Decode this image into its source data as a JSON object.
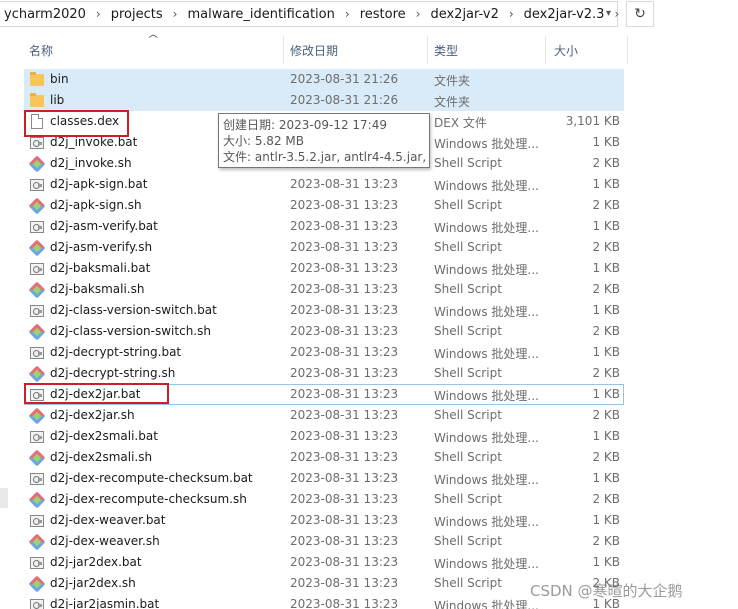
{
  "breadcrumb": [
    "ycharm2020",
    "projects",
    "malware_identification",
    "restore",
    "dex2jar-v2",
    "dex2jar-v2.3"
  ],
  "columns": {
    "name": "名称",
    "date": "修改日期",
    "type": "类型",
    "size": "大小"
  },
  "files": [
    {
      "name": "bin",
      "date": "2023-08-31 21:26",
      "type": "文件夹",
      "size": "",
      "icon": "folder-icon"
    },
    {
      "name": "lib",
      "date": "2023-08-31 21:26",
      "type": "文件夹",
      "size": "",
      "icon": "folder-icon"
    },
    {
      "name": "classes.dex",
      "date": "",
      "type": "DEX 文件",
      "size": "3,101 KB",
      "icon": "file-icon"
    },
    {
      "name": "d2j_invoke.bat",
      "date": "",
      "type": "Windows 批处理...",
      "size": "1 KB",
      "icon": "batch-file-icon"
    },
    {
      "name": "d2j_invoke.sh",
      "date": "",
      "type": "Shell Script",
      "size": "2 KB",
      "icon": "shell-script-icon"
    },
    {
      "name": "d2j-apk-sign.bat",
      "date": "2023-08-31 13:23",
      "type": "Windows 批处理...",
      "size": "1 KB",
      "icon": "batch-file-icon"
    },
    {
      "name": "d2j-apk-sign.sh",
      "date": "2023-08-31 13:23",
      "type": "Shell Script",
      "size": "2 KB",
      "icon": "shell-script-icon"
    },
    {
      "name": "d2j-asm-verify.bat",
      "date": "2023-08-31 13:23",
      "type": "Windows 批处理...",
      "size": "1 KB",
      "icon": "batch-file-icon"
    },
    {
      "name": "d2j-asm-verify.sh",
      "date": "2023-08-31 13:23",
      "type": "Shell Script",
      "size": "2 KB",
      "icon": "shell-script-icon"
    },
    {
      "name": "d2j-baksmali.bat",
      "date": "2023-08-31 13:23",
      "type": "Windows 批处理...",
      "size": "1 KB",
      "icon": "batch-file-icon"
    },
    {
      "name": "d2j-baksmali.sh",
      "date": "2023-08-31 13:23",
      "type": "Shell Script",
      "size": "2 KB",
      "icon": "shell-script-icon"
    },
    {
      "name": "d2j-class-version-switch.bat",
      "date": "2023-08-31 13:23",
      "type": "Windows 批处理...",
      "size": "1 KB",
      "icon": "batch-file-icon"
    },
    {
      "name": "d2j-class-version-switch.sh",
      "date": "2023-08-31 13:23",
      "type": "Shell Script",
      "size": "2 KB",
      "icon": "shell-script-icon"
    },
    {
      "name": "d2j-decrypt-string.bat",
      "date": "2023-08-31 13:23",
      "type": "Windows 批处理...",
      "size": "1 KB",
      "icon": "batch-file-icon"
    },
    {
      "name": "d2j-decrypt-string.sh",
      "date": "2023-08-31 13:23",
      "type": "Shell Script",
      "size": "2 KB",
      "icon": "shell-script-icon"
    },
    {
      "name": "d2j-dex2jar.bat",
      "date": "2023-08-31 13:23",
      "type": "Windows 批处理...",
      "size": "1 KB",
      "icon": "batch-file-icon"
    },
    {
      "name": "d2j-dex2jar.sh",
      "date": "2023-08-31 13:23",
      "type": "Shell Script",
      "size": "2 KB",
      "icon": "shell-script-icon"
    },
    {
      "name": "d2j-dex2smali.bat",
      "date": "2023-08-31 13:23",
      "type": "Windows 批处理...",
      "size": "1 KB",
      "icon": "batch-file-icon"
    },
    {
      "name": "d2j-dex2smali.sh",
      "date": "2023-08-31 13:23",
      "type": "Shell Script",
      "size": "2 KB",
      "icon": "shell-script-icon"
    },
    {
      "name": "d2j-dex-recompute-checksum.bat",
      "date": "2023-08-31 13:23",
      "type": "Windows 批处理...",
      "size": "1 KB",
      "icon": "batch-file-icon"
    },
    {
      "name": "d2j-dex-recompute-checksum.sh",
      "date": "2023-08-31 13:23",
      "type": "Shell Script",
      "size": "2 KB",
      "icon": "shell-script-icon"
    },
    {
      "name": "d2j-dex-weaver.bat",
      "date": "2023-08-31 13:23",
      "type": "Windows 批处理...",
      "size": "1 KB",
      "icon": "batch-file-icon"
    },
    {
      "name": "d2j-dex-weaver.sh",
      "date": "2023-08-31 13:23",
      "type": "Shell Script",
      "size": "2 KB",
      "icon": "shell-script-icon"
    },
    {
      "name": "d2j-jar2dex.bat",
      "date": "2023-08-31 13:23",
      "type": "Windows 批处理...",
      "size": "1 KB",
      "icon": "batch-file-icon"
    },
    {
      "name": "d2j-jar2dex.sh",
      "date": "2023-08-31 13:23",
      "type": "Shell Script",
      "size": "2 KB",
      "icon": "shell-script-icon"
    },
    {
      "name": "d2j-jar2jasmin.bat",
      "date": "2023-08-31 13:23",
      "type": "Windows 批处理...",
      "size": "1 KB",
      "icon": "batch-file-icon"
    }
  ],
  "tooltip": {
    "created": "创建日期: 2023-09-12 17:49",
    "size": "大小: 5.82 MB",
    "files": "文件: antlr-3.5.2.jar, antlr4-4.5.jar, ..."
  },
  "watermark": "CSDN @寒暄的大企鹅",
  "colors": {
    "selection": "#d9ebf9",
    "annotation": "#d21c24",
    "header_text": "#4c607a"
  }
}
